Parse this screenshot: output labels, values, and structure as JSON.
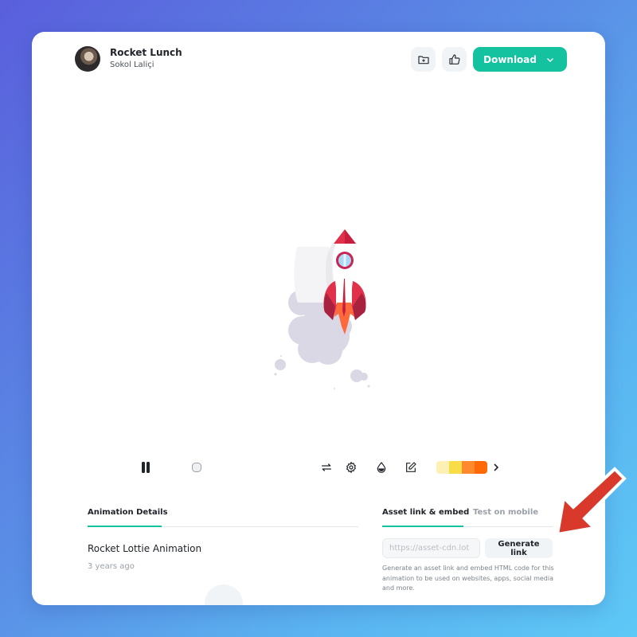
{
  "header": {
    "animation_name": "Rocket Lunch",
    "author": "Sokol Laliçi",
    "download_label": "Download"
  },
  "icons": {
    "add_to_folder": "folder-plus-icon",
    "like": "thumbs-up-icon",
    "download_caret": "chevron-down-icon"
  },
  "player": {
    "state": "playing",
    "controls": [
      "pause",
      "frame-marker",
      "loop",
      "settings",
      "background-color",
      "edit",
      "color-palette",
      "next"
    ],
    "palette": [
      "#fdf0b4",
      "#f8dc48",
      "#ff8a2e",
      "#ff6a08"
    ]
  },
  "details": {
    "tab_label": "Animation Details",
    "title": "Rocket Lottie Animation",
    "time": "3 years ago"
  },
  "embed": {
    "tabs": [
      {
        "label": "Asset link & embed",
        "active": true
      },
      {
        "label": "Test on mobile",
        "active": false
      }
    ],
    "link_placeholder": "https://asset-cdn.lot",
    "generate_label": "Generate link",
    "description": "Generate an asset link and embed HTML code for this animation to be used on websites, apps, social media and more."
  },
  "colors": {
    "accent": "#14c2a0",
    "arrow": "#d8392b",
    "rocket_red": "#e0304a",
    "flame": "#ff6a3d",
    "smoke": "#d9d8e4"
  }
}
